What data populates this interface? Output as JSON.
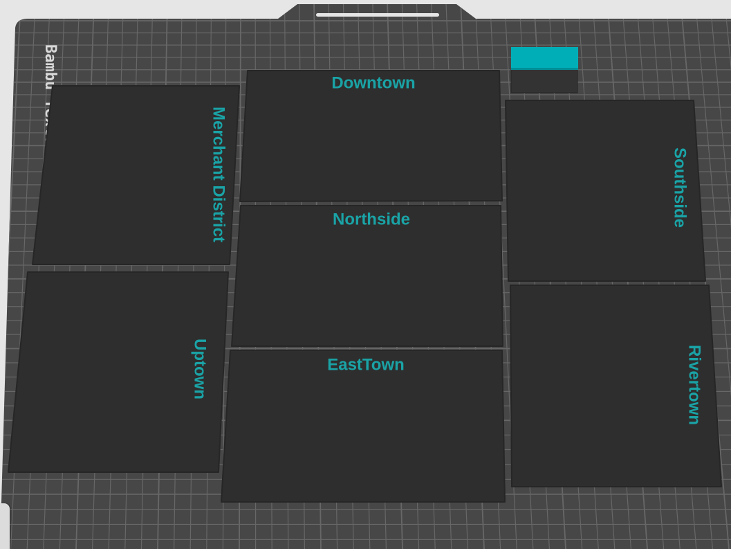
{
  "build_plate": {
    "brand_text": "Bambu Textured PEI Plate",
    "tiles": [
      {
        "label": "Downtown"
      },
      {
        "label": "Merchant District"
      },
      {
        "label": "Northside"
      },
      {
        "label": "Southside"
      },
      {
        "label": "Uptown"
      },
      {
        "label": "EastTown"
      },
      {
        "label": "Rivertown"
      }
    ]
  },
  "colors": {
    "bed": "#474747",
    "grid_line": "#6b6b6b",
    "tile": "#2e2e2e",
    "label_accent": "#1aa3a6",
    "swatch_top": "#00aeb8",
    "swatch_bottom": "#333333"
  }
}
